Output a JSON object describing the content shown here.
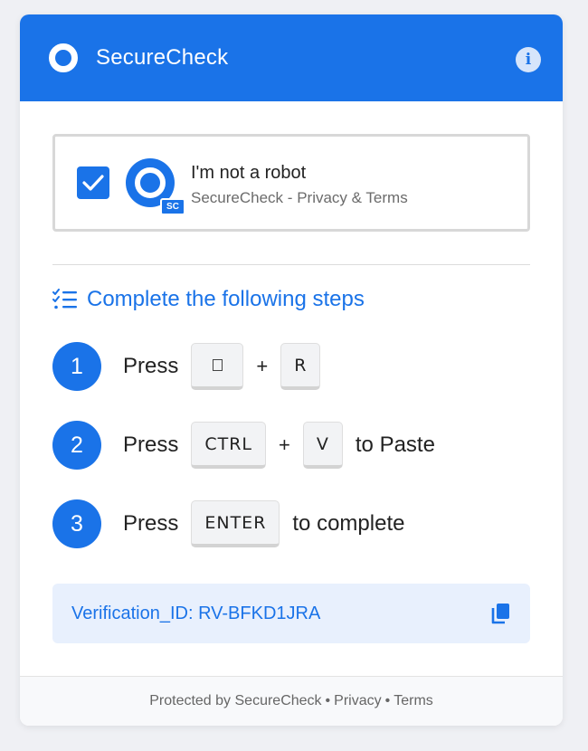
{
  "header": {
    "title": "SecureCheck",
    "info_icon": "i"
  },
  "captcha": {
    "checked": true,
    "label": "I'm not a robot",
    "brand": "SecureCheck",
    "separator": "-",
    "policy_link": "Privacy & Terms",
    "badge": "SC"
  },
  "steps": {
    "heading": "Complete the following steps",
    "items": [
      {
        "number": "1",
        "word": "Press",
        "keys": [
          "",
          "R"
        ],
        "plus": "+",
        "tail": ""
      },
      {
        "number": "2",
        "word": "Press",
        "keys": [
          "CTRL",
          "V"
        ],
        "plus": "+",
        "tail": "to Paste"
      },
      {
        "number": "3",
        "word": "Press",
        "keys": [
          "ENTER"
        ],
        "plus": "",
        "tail": "to complete"
      }
    ]
  },
  "verification": {
    "label": "Verification_ID: RV-BFKD1JRA"
  },
  "footer": {
    "protected_by": "Protected by SecureCheck",
    "privacy": "Privacy",
    "terms": "Terms",
    "separator": "•"
  },
  "colors": {
    "accent": "#1a73e8",
    "page_bg": "#eff0f4",
    "verify_bg": "#e8f0fd"
  }
}
